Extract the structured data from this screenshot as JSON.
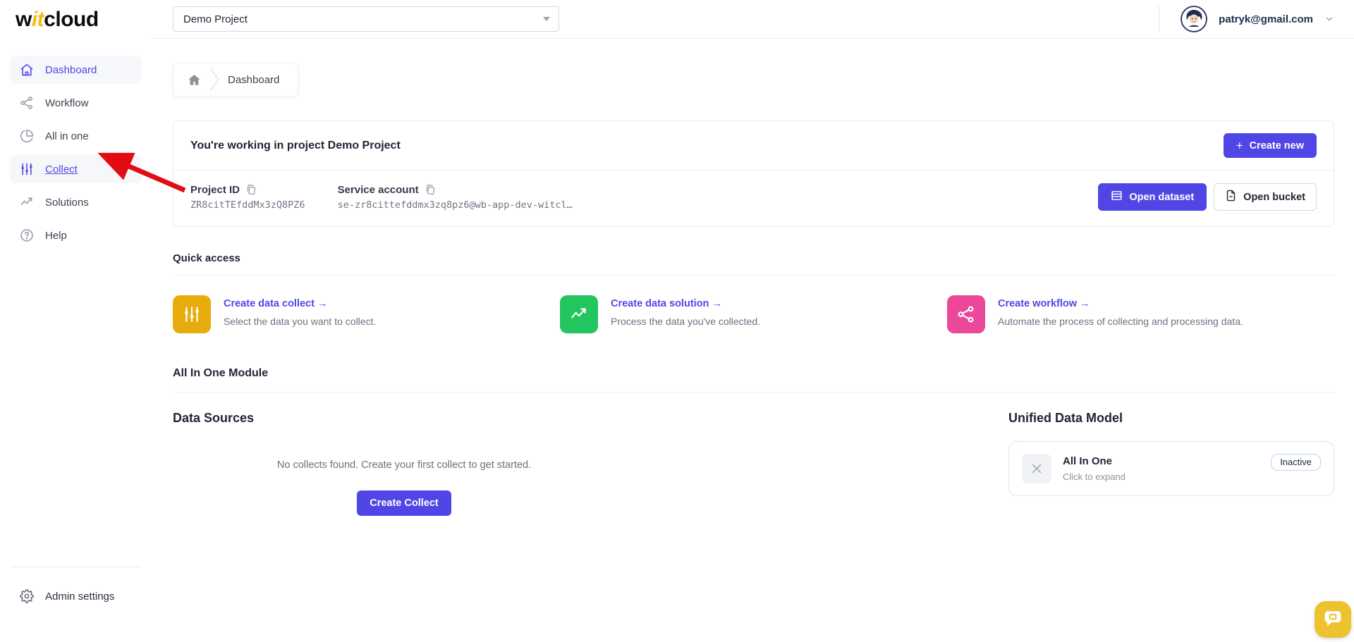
{
  "app": {
    "logo_w": "w",
    "logo_it": "it",
    "logo_cloud": "cloud"
  },
  "topbar": {
    "project_selector_value": "Demo Project",
    "user_email": "patryk@gmail.com"
  },
  "sidebar": {
    "items": [
      {
        "label": "Dashboard",
        "icon": "home-icon",
        "state": "active"
      },
      {
        "label": "Workflow",
        "icon": "share-nodes-icon",
        "state": "default"
      },
      {
        "label": "All in one",
        "icon": "pie-chart-icon",
        "state": "default"
      },
      {
        "label": "Collect",
        "icon": "sliders-icon",
        "state": "highlighted-by-arrow"
      },
      {
        "label": "Solutions",
        "icon": "trending-up-icon",
        "state": "default"
      },
      {
        "label": "Help",
        "icon": "question-circle-icon",
        "state": "default"
      }
    ],
    "admin_settings_label": "Admin settings"
  },
  "breadcrumb": {
    "current_page": "Dashboard"
  },
  "project_card": {
    "title": "You're working in project Demo Project",
    "create_new_label": "Create new",
    "fields": [
      {
        "label": "Project ID",
        "value": "ZR8citTEfddMx3zQ8PZ6"
      },
      {
        "label": "Service account",
        "value": "se-zr8cittefddmx3zq8pz6@wb-app-dev-witcl…"
      }
    ],
    "open_dataset_label": "Open dataset",
    "open_bucket_label": "Open bucket"
  },
  "quick_access": {
    "title": "Quick access",
    "cards": [
      {
        "title": "Create data collect →",
        "description": "Select the data you want to collect.",
        "icon": "sliders-icon",
        "color": "#e7ac0b"
      },
      {
        "title": "Create data solution →",
        "description": "Process the data you've collected.",
        "icon": "trending-up-icon",
        "color": "#22c55e"
      },
      {
        "title": "Create workflow →",
        "description": "Automate the process of collecting and processing data.",
        "icon": "share-nodes-icon",
        "color": "#ec4899"
      }
    ]
  },
  "all_in_one_module": {
    "title": "All In One Module"
  },
  "data_sources": {
    "title": "Data Sources",
    "empty_text": "No collects found. Create your first collect to get started.",
    "create_button_label": "Create Collect"
  },
  "unified_data_model": {
    "title": "Unified Data Model",
    "card": {
      "title": "All In One",
      "subtitle": "Click to expand",
      "status": "Inactive"
    }
  },
  "colors": {
    "accent_indigo": "#4f46e5",
    "logo_yellow": "#f5b914",
    "quick_access_yellow": "#e7ac0b",
    "quick_access_green": "#22c55e",
    "quick_access_pink": "#ec4899",
    "annotation_arrow_red": "#e30b13",
    "chat_widget_yellow": "#ecc32f"
  }
}
